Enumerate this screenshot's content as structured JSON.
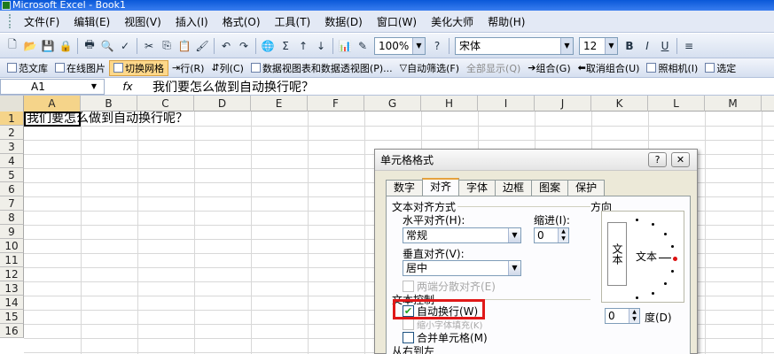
{
  "window": {
    "title": "Microsoft Excel - Book1"
  },
  "menu": [
    "文件(F)",
    "编辑(E)",
    "视图(V)",
    "插入(I)",
    "格式(O)",
    "工具(T)",
    "数据(D)",
    "窗口(W)",
    "美化大师",
    "帮助(H)"
  ],
  "toolbar": {
    "zoom": "100%",
    "font": "宋体",
    "font_size": "12",
    "bold": "B",
    "italic": "I",
    "underline": "U",
    "sigma": "Σ"
  },
  "toolbar2": {
    "items": [
      "范文库",
      "在线图片",
      "切换网格",
      "行(R)",
      "列(C)",
      "数据视图表和数据透视图(P)...",
      "自动筛选(F)",
      "全部显示(Q)",
      "组合(G)",
      "取消组合(U)",
      "照相机(I)",
      "选定"
    ]
  },
  "formula_bar": {
    "name_box": "A1",
    "fx": "fx",
    "content": "我们要怎么做到自动换行呢？"
  },
  "sheet": {
    "columns": [
      "A",
      "B",
      "C",
      "D",
      "E",
      "F",
      "G",
      "H",
      "I",
      "J",
      "K",
      "L",
      "M"
    ],
    "rows": [
      "1",
      "2",
      "3",
      "4",
      "5",
      "6",
      "7",
      "8",
      "9",
      "10",
      "11",
      "12",
      "13",
      "14",
      "15",
      "16"
    ],
    "a1_text": "我们要怎么做到自动换行呢？"
  },
  "dialog": {
    "title": "单元格格式",
    "help": "?",
    "close": "✕",
    "tabs": [
      "数字",
      "对齐",
      "字体",
      "边框",
      "图案",
      "保护"
    ],
    "active_tab": "对齐",
    "text_align_section": "文本对齐方式",
    "horizontal_label": "水平对齐(H):",
    "horizontal_value": "常规",
    "indent_label": "缩进(I):",
    "indent_value": "0",
    "vertical_label": "垂直对齐(V):",
    "vertical_value": "居中",
    "distributed_label": "两端分散对齐(E)",
    "text_control_section": "文本控制",
    "wrap_label": "自动换行(W)",
    "wrap_checked": true,
    "shrink_label": "缩小字体填充(K)",
    "merge_label": "合并单元格(M)",
    "rtl_section": "从右到左",
    "orientation_section": "方向",
    "vertical_text": "文本",
    "horizontal_text": "文本",
    "degree_value": "0",
    "degree_label": "度(D)"
  }
}
